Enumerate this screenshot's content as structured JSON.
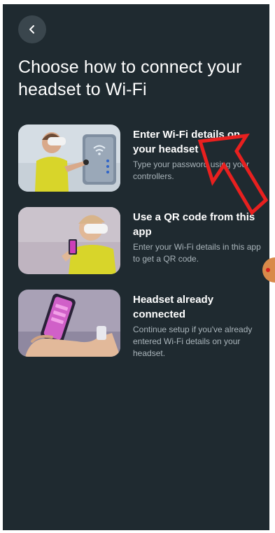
{
  "header": {
    "back_icon": "chevron-left-icon",
    "title": "Choose how to connect your headset to Wi-Fi"
  },
  "options": [
    {
      "heading": "Enter Wi-Fi details on your headset",
      "description": "Type your password using your controllers.",
      "image": "person-headset-wifi-panel"
    },
    {
      "heading": "Use a QR code from this app",
      "description": "Enter your Wi-Fi details in this app to get a QR code.",
      "image": "person-headset-phone"
    },
    {
      "heading": "Headset already connected",
      "description": "Continue setup if you've already entered Wi-Fi details on your headset.",
      "image": "hand-holding-phone"
    }
  ],
  "colors": {
    "background": "#1f2a30",
    "annotation_arrow": "#e8201f"
  }
}
